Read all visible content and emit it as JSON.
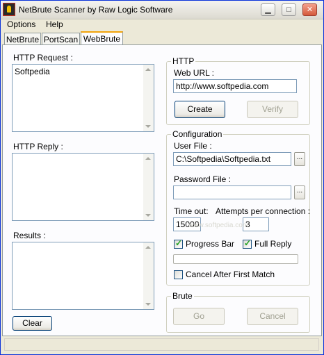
{
  "window": {
    "title": "NetBrute Scanner by Raw Logic Software"
  },
  "menu": {
    "items": [
      "Options",
      "Help"
    ]
  },
  "tabs": [
    "NetBrute",
    "PortScan",
    "WebBrute"
  ],
  "active_tab": "WebBrute",
  "left": {
    "http_request_label": "HTTP Request :",
    "http_request_value": "Softpedia",
    "http_reply_label": "HTTP Reply :",
    "results_label": "Results :",
    "clear_label": "Clear"
  },
  "http_group": {
    "title": "HTTP",
    "web_url_label": "Web URL :",
    "web_url_value": "http://www.softpedia.com",
    "create_label": "Create",
    "verify_label": "Verify"
  },
  "config_group": {
    "title": "Configuration",
    "user_file_label": "User File :",
    "user_file_value": "C:\\Softpedia\\Softpedia.txt",
    "browse_label": "...",
    "password_file_label": "Password File :",
    "password_file_value": "",
    "timeout_label": "Time out:",
    "timeout_value": "15000",
    "attempts_label": "Attempts per connection :",
    "attempts_value": "3",
    "progress_bar_label": "Progress Bar",
    "progress_bar_checked": true,
    "full_reply_label": "Full Reply",
    "full_reply_checked": true,
    "progress_fraction": 0,
    "cancel_label": "Cancel After First Match",
    "cancel_checked": false
  },
  "brute_group": {
    "title": "Brute",
    "go_label": "Go",
    "cancel_label": "Cancel"
  },
  "watermark": "www.softpedia.com"
}
